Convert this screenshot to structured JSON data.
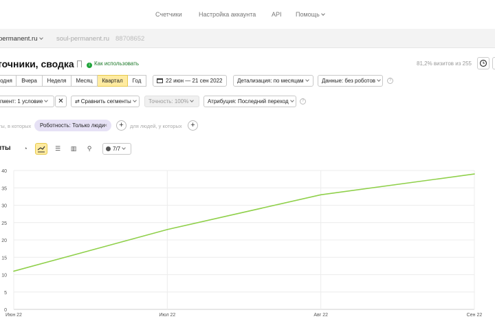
{
  "topnav": {
    "items": [
      "Счетчики",
      "Настройка аккаунта",
      "API",
      "Помощь"
    ]
  },
  "counter": {
    "current": "permanent.ru",
    "site": "soul-permanent.ru",
    "id": "88708652"
  },
  "report": {
    "title": "точники, сводка",
    "howto": "Как использовать",
    "visits_note": "81,2% визитов из 255"
  },
  "periods": {
    "tabs": [
      "одня",
      "Вчера",
      "Неделя",
      "Месяц",
      "Квартал",
      "Год"
    ],
    "active_index": 4,
    "date_range": "22 июн — 21 сен 2022",
    "detail": "Детализация: по месяцам",
    "data": "Данные: без роботов"
  },
  "segments": {
    "segment": "гмент: 1 условие",
    "compare": "Сравнить сегменты",
    "accuracy": "Точность: 100%",
    "attribution": "Атрибуция: Последний переход"
  },
  "filters": {
    "visits_text": "ты, в которых",
    "chip": "Роботность: Только люди",
    "people_text": "для людей, у которых"
  },
  "viz": {
    "label": "иты",
    "metrics": "7/7"
  },
  "colors": {
    "line": "#8fd04a",
    "active_tab": "#ffeba0",
    "chip": "#e6e1f5"
  },
  "chart_data": {
    "type": "line",
    "x": [
      "Июн 22",
      "Июл 22",
      "Авг 22",
      "Сен 22"
    ],
    "series": [
      {
        "values": [
          11,
          23,
          33,
          39
        ]
      }
    ],
    "ylim": [
      0,
      40
    ],
    "yticks": [
      0,
      5,
      10,
      15,
      20,
      25,
      30,
      35,
      40
    ],
    "grid": true
  }
}
